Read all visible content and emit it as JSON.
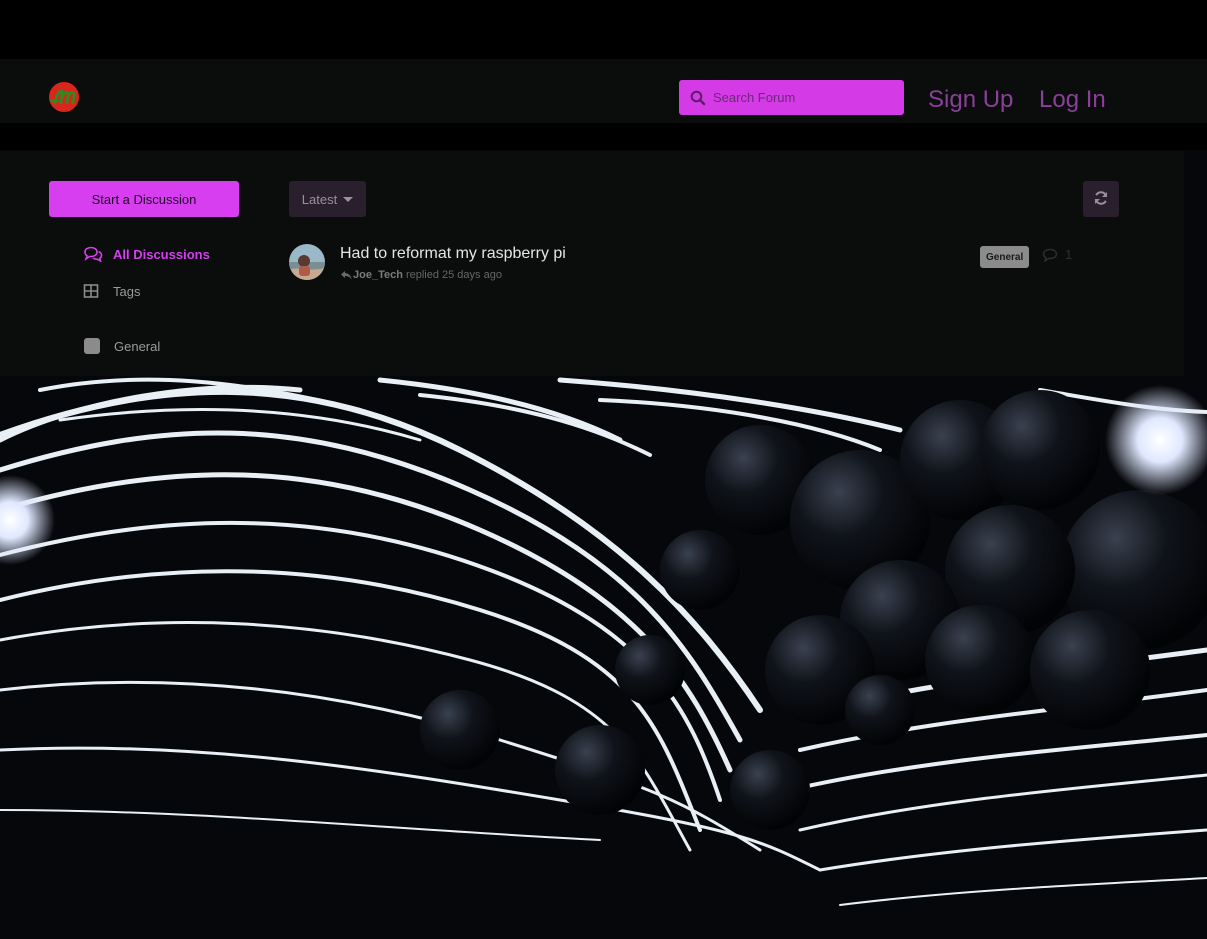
{
  "header": {
    "search_placeholder": "Search Forum",
    "signup_label": "Sign Up",
    "login_label": "Log In"
  },
  "sidebar": {
    "start_label": "Start a Discussion",
    "items": [
      {
        "label": "All Discussions",
        "icon": "comments-icon",
        "active": true
      },
      {
        "label": "Tags",
        "icon": "tags-grid-icon",
        "active": false
      }
    ],
    "tags": [
      {
        "label": "General",
        "color": "#8b8b8b"
      }
    ]
  },
  "toolbar": {
    "sort_label": "Latest",
    "refresh_icon": "refresh-icon"
  },
  "discussions": [
    {
      "title": "Had to reformat my raspberry pi",
      "user": "Joe_Tech",
      "action": "replied 25 days ago",
      "tag": "General",
      "replies": "1"
    }
  ],
  "colors": {
    "accent": "#d63ef0",
    "panel": "#0b0c0c",
    "tag_general": "#8b8b8b"
  }
}
